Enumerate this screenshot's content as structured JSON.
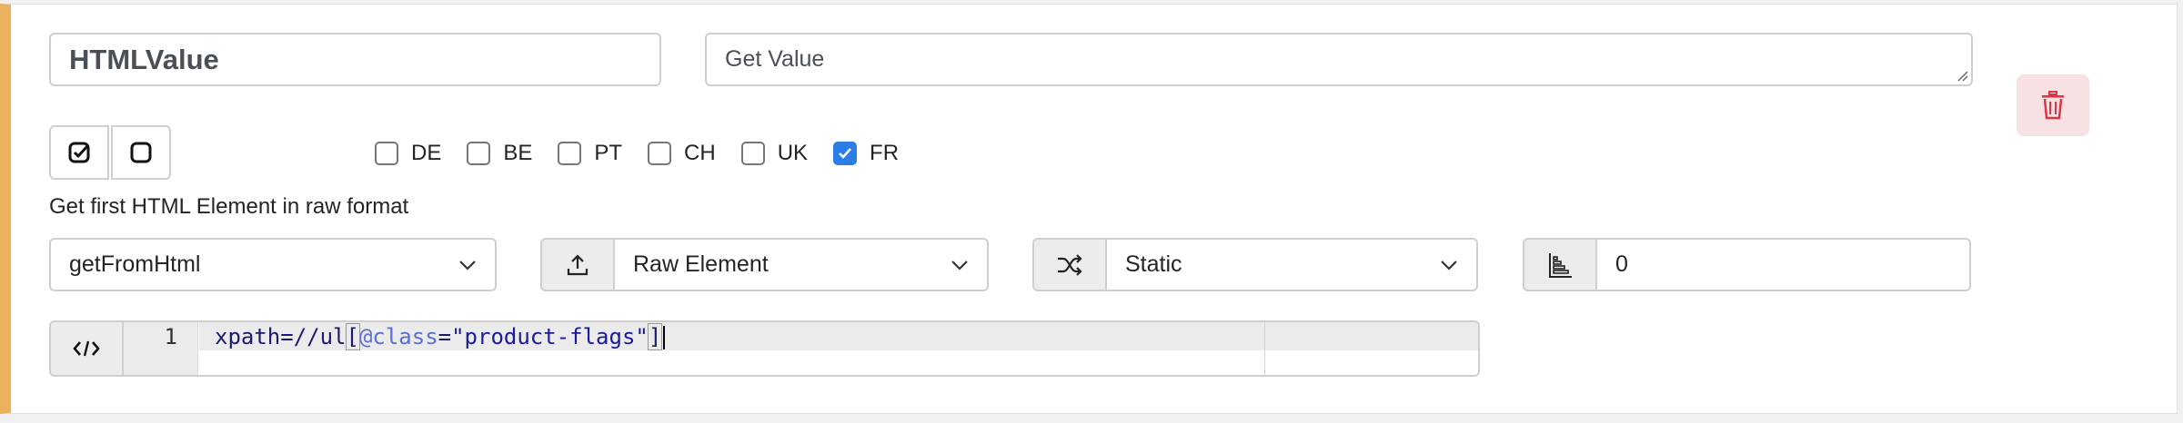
{
  "step": {
    "name_value": "HTMLValue",
    "description_value": "Get Value",
    "step_description": "Get first HTML Element in raw format"
  },
  "countries": [
    {
      "label": "DE",
      "checked": false
    },
    {
      "label": "BE",
      "checked": false
    },
    {
      "label": "PT",
      "checked": false
    },
    {
      "label": "CH",
      "checked": false
    },
    {
      "label": "UK",
      "checked": false
    },
    {
      "label": "FR",
      "checked": true
    }
  ],
  "controls": {
    "method_selected": "getFromHtml",
    "output_selected": "Raw Element",
    "mode_selected": "Static",
    "index_value": "0"
  },
  "code": {
    "line_number": "1",
    "tokens": {
      "prefix": "xpath=//ul",
      "open_bracket": "[",
      "attr": "@class",
      "equals": "=",
      "string": "\"product-flags\"",
      "close_bracket": "]"
    }
  },
  "icons": {
    "delete": "trash-icon",
    "check_all": "check-square-icon",
    "uncheck_all": "square-icon",
    "output": "upload-icon",
    "mode": "shuffle-icon",
    "index": "sort-bars-icon",
    "code": "code-icon",
    "dropdown": "chevron-down-icon"
  },
  "colors": {
    "card_accent": "#ecb15f",
    "checkbox_checked": "#2d7de6",
    "delete_bg": "#f8e1e3",
    "delete_icon": "#dc3545"
  }
}
